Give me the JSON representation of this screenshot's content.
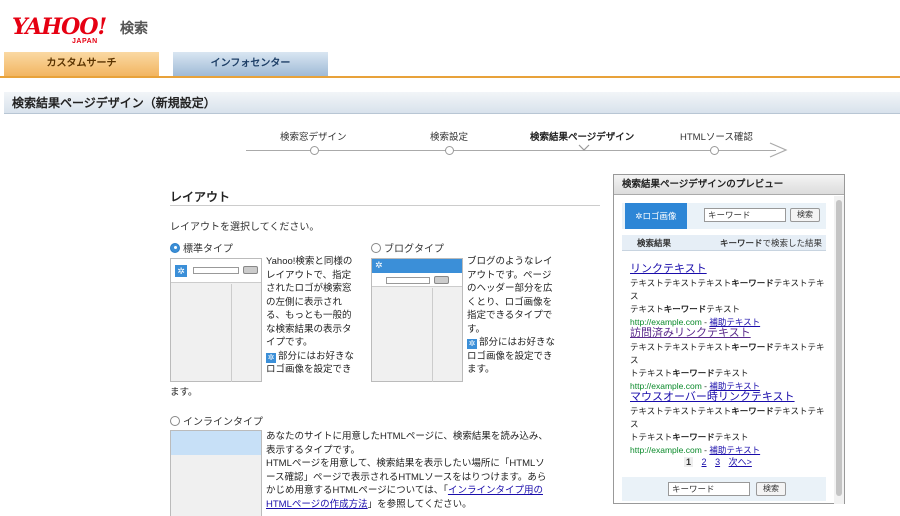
{
  "brand": {
    "logo": "YAHOO!",
    "logo_sub": "JAPAN",
    "service": "検索",
    "accent": "#e60012"
  },
  "tabs": [
    {
      "label": "カスタムサーチ",
      "active": true
    },
    {
      "label": "インフォセンター",
      "active": false
    }
  ],
  "page_title": "検索結果ページデザイン（新規設定）",
  "steps": [
    {
      "label": "検索窓デザイン",
      "current": false
    },
    {
      "label": "検索設定",
      "current": false
    },
    {
      "label": "検索結果ページデザイン",
      "current": true
    },
    {
      "label": "HTMLソース確認",
      "current": false
    }
  ],
  "layout": {
    "title": "レイアウト",
    "instruction": "レイアウトを選択してください。",
    "options": [
      {
        "label": "標準タイプ",
        "selected": true,
        "desc_lines": [
          "Yahoo!検索と同様の",
          "レイアウトで、指定",
          "されたロゴが検索窓",
          "の左側に表示され",
          "る、もっとも一般的",
          "な検索結果の表示タ",
          "イプです。"
        ],
        "note": "部分にはお好きな",
        "note2": "ロゴ画像を設定でき",
        "trailing": "ます。"
      },
      {
        "label": "ブログタイプ",
        "selected": false,
        "desc_lines": [
          "ブログのようなレイ",
          "アウトです。ページ",
          "のヘッダー部分を広",
          "くとり、ロゴ画像を",
          "指定できるタイプで",
          "す。"
        ],
        "note": "部分にはお好きな",
        "note2": "ロゴ画像を設定でき",
        "note3": "ます。"
      },
      {
        "label": "インラインタイプ",
        "selected": false,
        "desc_lines": [
          "あなたのサイトに用意したHTMLページに、検索結果を読み込み、",
          "表示するタイプです。",
          "HTMLページを用意して、検索結果を表示したい場所に「HTMLソ",
          "ース確認」ページで表示されるHTMLソースをはりつけます。あら"
        ],
        "desc_pre": "かじめ用意するHTMLページについては、「",
        "link_1": "インラインタイプ用の",
        "link_2": "HTMLページの作成方法",
        "desc_post": "」を参照してください。"
      }
    ]
  },
  "preview": {
    "title": "検索結果ページデザインのプレビュー",
    "logo_label": "ロゴ画像",
    "input_value": "キーワード",
    "search_button": "検索",
    "results_label": "検索結果",
    "results_keyword": "キーワード",
    "results_suffix": "で検索した結果",
    "results": [
      {
        "title": "リンクテキスト",
        "state": "normal"
      },
      {
        "title": "訪問済みリンクテキスト",
        "state": "visited"
      },
      {
        "title": "マウスオーバー時リンクテキスト",
        "state": "hover"
      }
    ],
    "snippet_a": "テキストテキストテキスト",
    "snippet_kw": "キーワード",
    "snippet_b": "テキストテキス",
    "snippet_c": "トテキスト",
    "snippet_d": "テキスト",
    "url": "http://example.com",
    "sep": " - ",
    "sub_link": "補助テキスト",
    "pager": {
      "current": "1",
      "pages": [
        "2",
        "3"
      ],
      "next": "次へ>"
    },
    "footer_input": "キーワード",
    "footer_button": "検索"
  }
}
